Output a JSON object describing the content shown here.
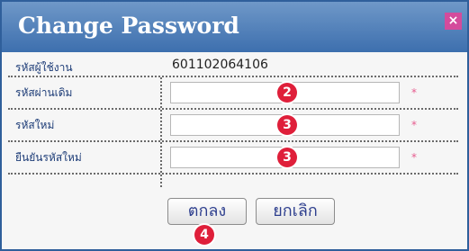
{
  "dialog": {
    "title": "Change Password",
    "close_label": "×"
  },
  "fields": {
    "username": {
      "label": "รหัสผู้ใช้งาน",
      "value": "601102064106"
    },
    "old_password": {
      "label": "รหัสผ่านเดิม",
      "value": "",
      "required_mark": "*",
      "marker": "2"
    },
    "new_password": {
      "label": "รหัสใหม่",
      "value": "",
      "required_mark": "*",
      "marker": "3"
    },
    "confirm_password": {
      "label": "ยืนยันรหัสใหม่",
      "value": "",
      "required_mark": "*",
      "marker": "3"
    }
  },
  "buttons": {
    "ok_label": "ตกลง",
    "cancel_label": "ยกเลิก",
    "ok_marker": "4"
  },
  "colors": {
    "title_bar": "#3d6fae",
    "close": "#d44b9c",
    "marker": "#df1f3a",
    "required": "#e75c8f",
    "label_text": "#1d3c77"
  }
}
